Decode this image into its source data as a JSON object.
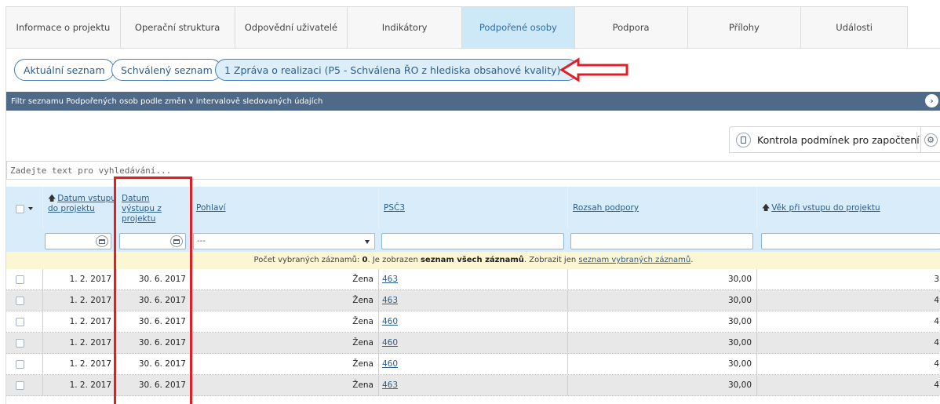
{
  "tabs": [
    {
      "label": "Informace o projektu",
      "active": false
    },
    {
      "label": "Operační struktura",
      "active": false
    },
    {
      "label": "Odpovědní uživatelé",
      "active": false
    },
    {
      "label": "Indikátory",
      "active": false
    },
    {
      "label": "Podpořené osoby",
      "active": true
    },
    {
      "label": "Podpora",
      "active": false
    },
    {
      "label": "Přílohy",
      "active": false
    },
    {
      "label": "Události",
      "active": false
    }
  ],
  "list_buttons": {
    "current": "Aktuální seznam",
    "approved": "Schválený seznam",
    "report": "1 Zpráva o realizaci (P5 - Schválena ŘO z hlediska obsahové kvality)"
  },
  "filter_bar": {
    "label": "Filtr seznamu Podpořených osob podle změn v intervalově sledovaných údajích"
  },
  "toolbar": {
    "check_conditions": "Kontrola podmínek pro započtení"
  },
  "search": {
    "placeholder": "Zadejte text pro vyhledávání..."
  },
  "table": {
    "headers": {
      "entry_date": "Datum vstupu do projektu",
      "exit_date": "Datum výstupu z projektu",
      "gender": "Pohlaví",
      "psc": "PSČ3",
      "support_scope": "Rozsah podpory",
      "age": "Věk při vstupu do projektu"
    },
    "filter_gender_value": "---",
    "info": {
      "prefix": "Počet vybraných záznamů: ",
      "count": "0",
      "mid": ". Je zobrazen ",
      "bold": "seznam všech záznamů",
      "after": ". Zobrazit jen ",
      "link": "seznam vybraných záznamů",
      "end": "."
    },
    "rows": [
      {
        "entry": "1. 2. 2017",
        "exit": "30. 6. 2017",
        "gender": "Žena",
        "psc": "463",
        "scope": "30,00",
        "age": "3"
      },
      {
        "entry": "1. 2. 2017",
        "exit": "30. 6. 2017",
        "gender": "Žena",
        "psc": "463",
        "scope": "30,00",
        "age": "4"
      },
      {
        "entry": "1. 2. 2017",
        "exit": "30. 6. 2017",
        "gender": "Žena",
        "psc": "460",
        "scope": "30,00",
        "age": "4"
      },
      {
        "entry": "1. 2. 2017",
        "exit": "30. 6. 2017",
        "gender": "Žena",
        "psc": "460",
        "scope": "30,00",
        "age": "4"
      },
      {
        "entry": "1. 2. 2017",
        "exit": "30. 6. 2017",
        "gender": "Žena",
        "psc": "460",
        "scope": "30,00",
        "age": "4"
      },
      {
        "entry": "1. 2. 2017",
        "exit": "30. 6. 2017",
        "gender": "Žena",
        "psc": "463",
        "scope": "30,00",
        "age": "4"
      }
    ]
  },
  "colors": {
    "accent": "#2b5e8e",
    "filter_bar": "#4e6a88",
    "header_bg": "#d8ecf9",
    "annotation": "#e01e25",
    "info_bg": "#fbf6d4"
  }
}
